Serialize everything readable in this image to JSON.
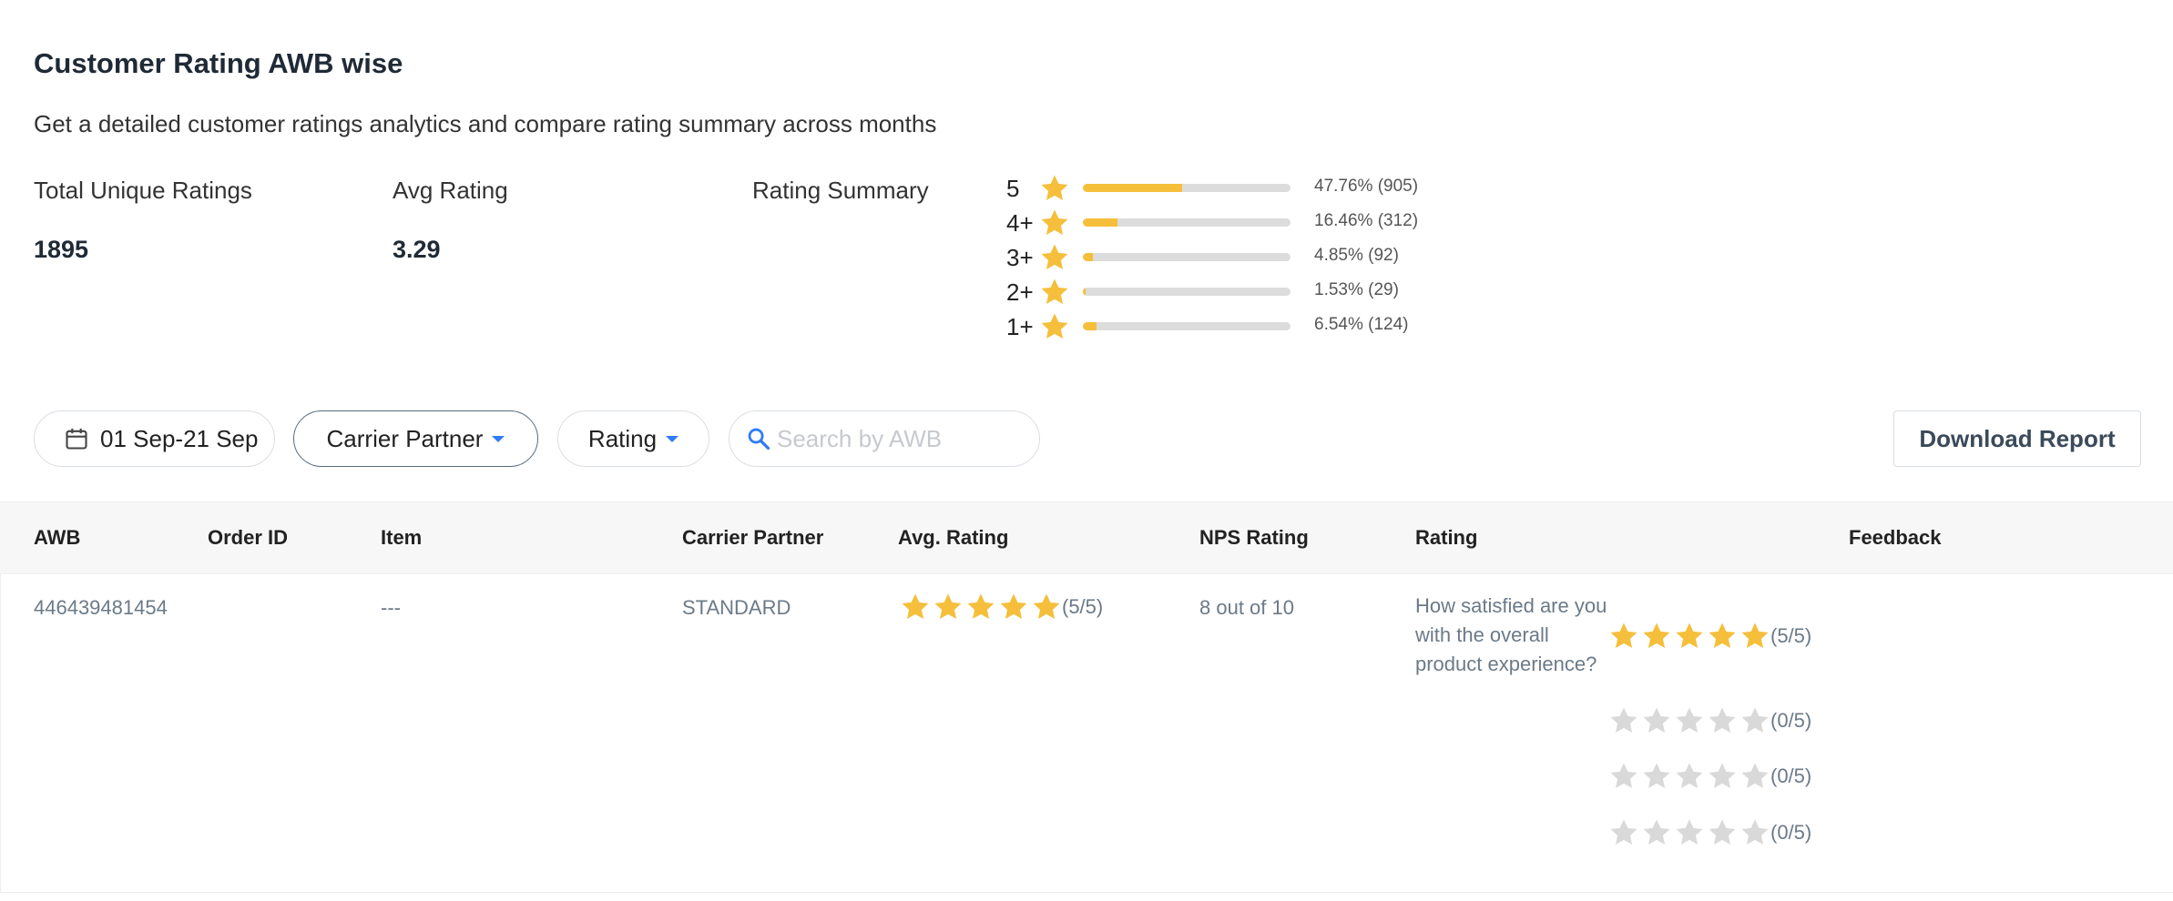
{
  "page": {
    "title": "Customer Rating AWB wise",
    "subtitle": "Get a detailed customer ratings analytics and compare rating summary across months"
  },
  "metrics": {
    "total_label": "Total Unique Ratings",
    "total_value": "1895",
    "avg_label": "Avg Rating",
    "avg_value": "3.29",
    "summary_label": "Rating Summary"
  },
  "rating_summary": [
    {
      "level": "5",
      "percent": 47.76,
      "text": "47.76% (905)"
    },
    {
      "level": "4+",
      "percent": 16.46,
      "text": "16.46% (312)"
    },
    {
      "level": "3+",
      "percent": 4.85,
      "text": "4.85% (92)"
    },
    {
      "level": "2+",
      "percent": 1.53,
      "text": "1.53% (29)"
    },
    {
      "level": "1+",
      "percent": 6.54,
      "text": "6.54% (124)"
    }
  ],
  "filters": {
    "date_range": "01 Sep-21 Sep",
    "carrier_partner": "Carrier Partner",
    "rating": "Rating",
    "search_placeholder": "Search by AWB",
    "download_label": "Download Report"
  },
  "table": {
    "headers": [
      "AWB",
      "Order ID",
      "Item",
      "Carrier Partner",
      "Avg. Rating",
      "NPS Rating",
      "Rating",
      "Feedback"
    ],
    "rows": [
      {
        "awb": "446439481454",
        "order_id": "",
        "item": "---",
        "carrier": "STANDARD",
        "avg_rating": 5,
        "avg_rating_text": "(5/5)",
        "nps": "8 out of 10",
        "question": "How satisfied are you with the overall product experience?",
        "ratings": [
          {
            "value": 5,
            "text": "(5/5)"
          },
          {
            "value": 0,
            "text": "(0/5)"
          },
          {
            "value": 0,
            "text": "(0/5)"
          },
          {
            "value": 0,
            "text": "(0/5)"
          }
        ],
        "feedback": ""
      }
    ]
  },
  "colors": {
    "star_filled": "#f5bf3b",
    "star_empty": "#d9d9d9",
    "bar_track": "#dcdcdc",
    "accent_blue": "#2f7cf6"
  }
}
